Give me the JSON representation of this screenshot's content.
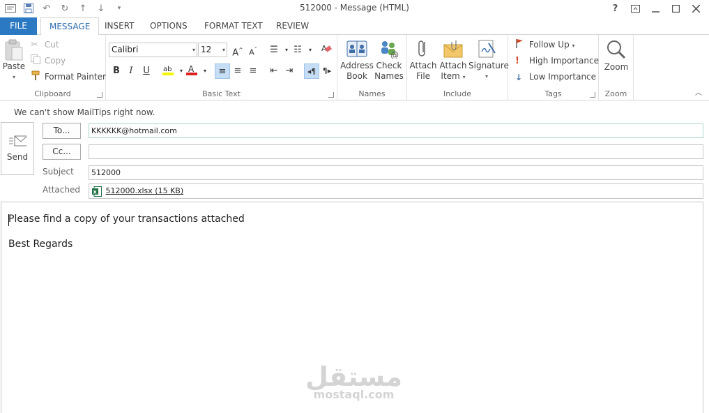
{
  "window": {
    "title": "512000 - Message (HTML)",
    "help": "?",
    "controls": [
      "restore-ribbon",
      "minimize",
      "maximize",
      "close"
    ]
  },
  "tabs": [
    {
      "label": "FILE"
    },
    {
      "label": "MESSAGE",
      "active": true
    },
    {
      "label": "INSERT"
    },
    {
      "label": "OPTIONS"
    },
    {
      "label": "FORMAT TEXT"
    },
    {
      "label": "REVIEW"
    }
  ],
  "ribbon": {
    "clipboard": {
      "label": "Clipboard",
      "paste": "Paste",
      "cut": "Cut",
      "copy": "Copy",
      "format_painter": "Format Painter"
    },
    "basic_text": {
      "label": "Basic Text",
      "font": "Calibri",
      "size": "12",
      "bold": "B",
      "italic": "I",
      "underline": "U"
    },
    "names": {
      "label": "Names",
      "address_book_1": "Address",
      "address_book_2": "Book",
      "check_names_1": "Check",
      "check_names_2": "Names"
    },
    "include": {
      "label": "Include",
      "attach_file_1": "Attach",
      "attach_file_2": "File",
      "attach_item_1": "Attach",
      "attach_item_2": "Item",
      "signature": "Signature"
    },
    "tags": {
      "label": "Tags",
      "follow_up": "Follow Up",
      "high": "High Importance",
      "low": "Low Importance"
    },
    "zoom": {
      "label": "Zoom",
      "zoom": "Zoom"
    }
  },
  "header": {
    "mailtips": "We can't show MailTips right now.",
    "send": "Send",
    "to_button": "To...",
    "cc_button": "Cc...",
    "subject_label": "Subject",
    "attached_label": "Attached",
    "to_value": "KKKKKK@hotmail.com",
    "cc_value": "",
    "subject_value": "512000",
    "attachment": "512000.xlsx (15 KB)"
  },
  "body": {
    "line1": "Please find a copy of your transactions attached",
    "line2": "Best Regards"
  },
  "watermark": {
    "arabic": "مستقل",
    "latin": "mostaql.com"
  },
  "colors": {
    "file_tab": "#2b79c2",
    "accent_text": "#2b6cb0",
    "selected_button": "#c5ddf5"
  }
}
